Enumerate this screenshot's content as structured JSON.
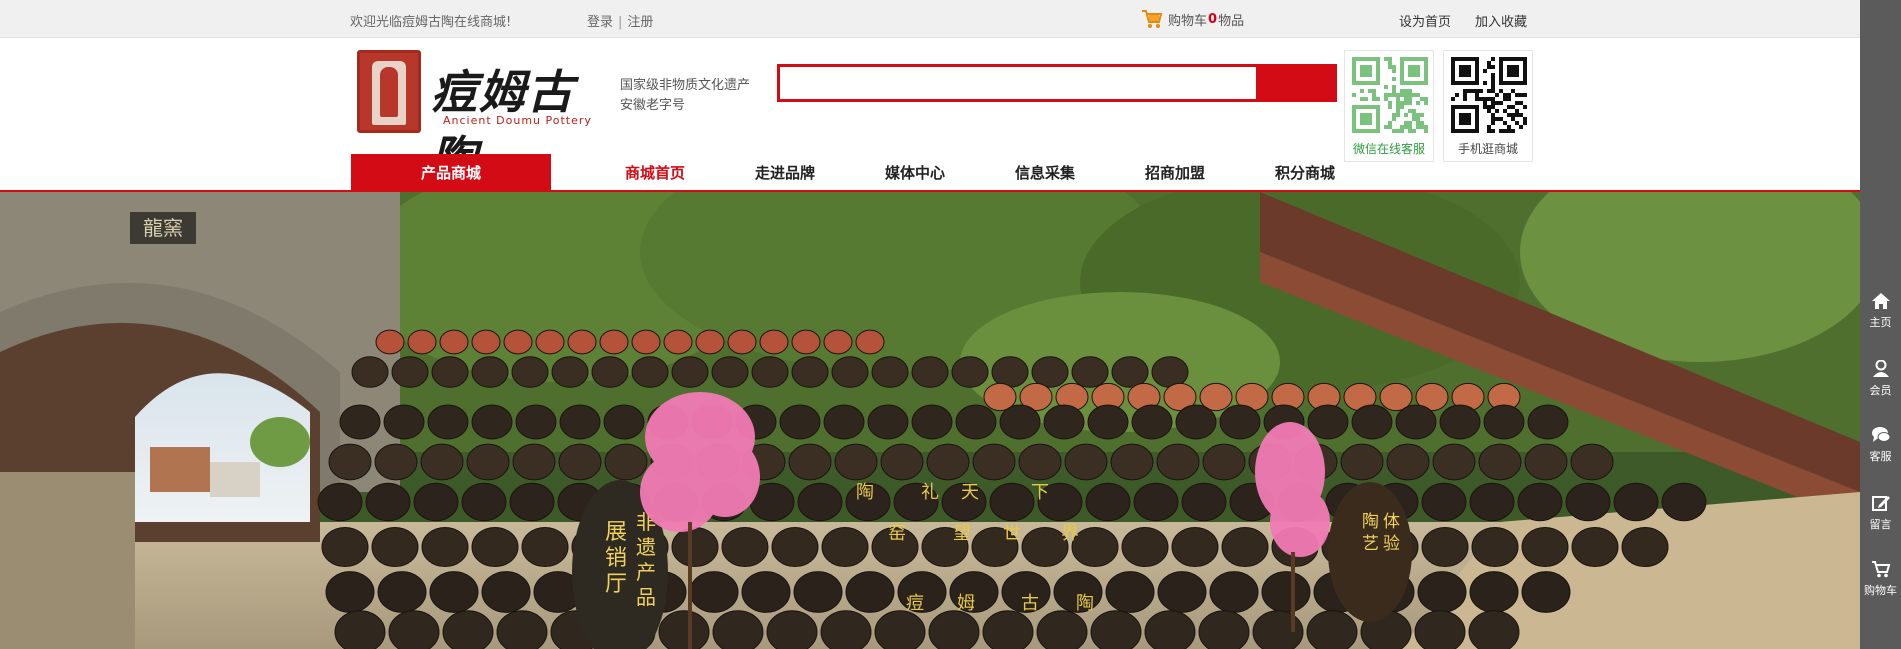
{
  "topbar": {
    "welcome": "欢迎光临痘姆古陶在线商城!",
    "login": "登录",
    "divider": "|",
    "register": "注册",
    "cart_label": "购物车",
    "cart_count": "0",
    "cart_unit": "物品",
    "set_home": "设为首页",
    "add_favorite": "加入收藏"
  },
  "logo": {
    "name": "痘姆古陶",
    "english": "Ancient Doumu Pottery"
  },
  "tagline": {
    "line1": "国家级非物质文化遗产",
    "line2": "安徽老字号"
  },
  "search": {
    "placeholder": "",
    "value": ""
  },
  "qr_codes": [
    {
      "caption": "微信在线客服",
      "icon": "wechat-qr"
    },
    {
      "caption": "手机逛商城",
      "icon": "mobile-qr"
    }
  ],
  "nav": {
    "category_label": "产品商城",
    "items": [
      {
        "label": "商城首页",
        "active": true
      },
      {
        "label": "走进品牌",
        "active": false
      },
      {
        "label": "媒体中心",
        "active": false
      },
      {
        "label": "信息采集",
        "active": false
      },
      {
        "label": "招商加盟",
        "active": false
      },
      {
        "label": "积分商城",
        "active": false
      }
    ]
  },
  "banner": {
    "gate_sign": "龍窯",
    "jar_left": [
      "展",
      "销",
      "厅",
      "非",
      "遗",
      "产",
      "品"
    ],
    "jar_right": [
      "陶",
      "艺",
      "体",
      "验"
    ],
    "wall_row1": [
      "陶",
      "礼",
      "天",
      "下"
    ],
    "wall_row2": [
      "窑",
      "望",
      "世",
      "界"
    ],
    "wall_row3": [
      "痘",
      "姆",
      "古",
      "陶"
    ]
  },
  "sidebar": [
    {
      "label": "主页",
      "icon": "home-icon"
    },
    {
      "label": "会员",
      "icon": "user-icon"
    },
    {
      "label": "客服",
      "icon": "chat-icon"
    },
    {
      "label": "留言",
      "icon": "edit-icon"
    },
    {
      "label": "购物车",
      "icon": "cart-icon"
    }
  ],
  "colors": {
    "brand_red": "#d30b15",
    "topbar_bg": "#f0f0f0",
    "sidebar_bg": "#5b5b5b",
    "wechat_green": "#2e9c3e"
  }
}
